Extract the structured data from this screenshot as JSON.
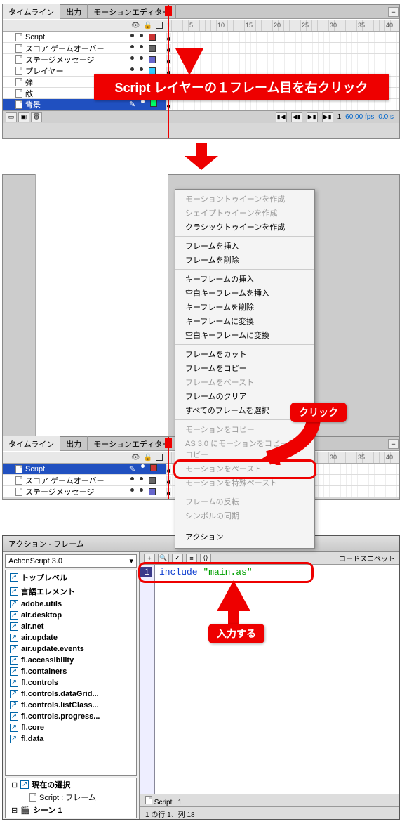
{
  "timeline": {
    "tabs": {
      "timeline": "タイムライン",
      "output": "出力",
      "motion": "モーションエディター"
    },
    "ruler_numbers": [
      "1",
      "5",
      "10",
      "15",
      "20",
      "25",
      "30",
      "35",
      "40"
    ],
    "layers": [
      {
        "name": "Script",
        "color": "#cc3333"
      },
      {
        "name": "スコア ゲームオーバー",
        "color": "#666666"
      },
      {
        "name": "ステージメッセージ",
        "color": "#6666cc"
      },
      {
        "name": "プレイヤー",
        "color": "#33ccff"
      },
      {
        "name": "弾",
        "color": "#cc00cc"
      },
      {
        "name": "敵",
        "color": "#6600cc"
      },
      {
        "name": "背景",
        "color": "#00ff66",
        "selected": true
      }
    ],
    "status": {
      "frame": "1",
      "fps": "60.00 fps",
      "time": "0.0 s"
    }
  },
  "callout1": "Script レイヤーの１フレーム目を右クリック",
  "callout2": "クリック",
  "callout3": "入力する",
  "context": {
    "sec1": [
      "モーショントゥイーンを作成",
      "シェイプトゥイーンを作成",
      "クラシックトゥイーンを作成"
    ],
    "sec2": [
      "フレームを挿入",
      "フレームを削除"
    ],
    "sec3": [
      "キーフレームの挿入",
      "空白キーフレームを挿入",
      "キーフレームを削除",
      "キーフレームに変換",
      "空白キーフレームに変換"
    ],
    "sec4": [
      "フレームをカット",
      "フレームをコピー",
      "フレームをペースト",
      "フレームのクリア",
      "すべてのフレームを選択"
    ],
    "sec5": [
      "モーションをコピー",
      "AS 3.0 にモーションをコピーしてコピー",
      "モーションをペースト",
      "モーションを特殊ペースト"
    ],
    "sec6": [
      "フレームの反転",
      "シンボルの同期"
    ],
    "action": "アクション"
  },
  "timeline2": {
    "layers": [
      {
        "name": "Script",
        "color": "#cc3333",
        "selected": true
      },
      {
        "name": "スコア ゲームオーバー",
        "color": "#666666"
      },
      {
        "name": "ステージメッセージ",
        "color": "#6666cc"
      }
    ]
  },
  "action_panel": {
    "title": "アクション - フレーム",
    "version": "ActionScript 3.0",
    "snippet_label": "コードスニペット",
    "tree": [
      "トップレベル",
      "言語エレメント",
      "adobe.utils",
      "air.desktop",
      "air.net",
      "air.update",
      "air.update.events",
      "fl.accessibility",
      "fl.containers",
      "fl.controls",
      "fl.controls.dataGrid...",
      "fl.controls.listClass...",
      "fl.controls.progress...",
      "fl.core",
      "fl.data"
    ],
    "nav": {
      "current_sel": "現在の選択",
      "script_frame": "Script : フレーム",
      "scene": "シーン 1",
      "script_frame2": "Script : フレーム"
    },
    "code_line": "1",
    "code_include": "include",
    "code_string": "\"main.as\"",
    "footer_tab": "Script : 1",
    "footer_pos": "1 の行 1、列 18"
  }
}
